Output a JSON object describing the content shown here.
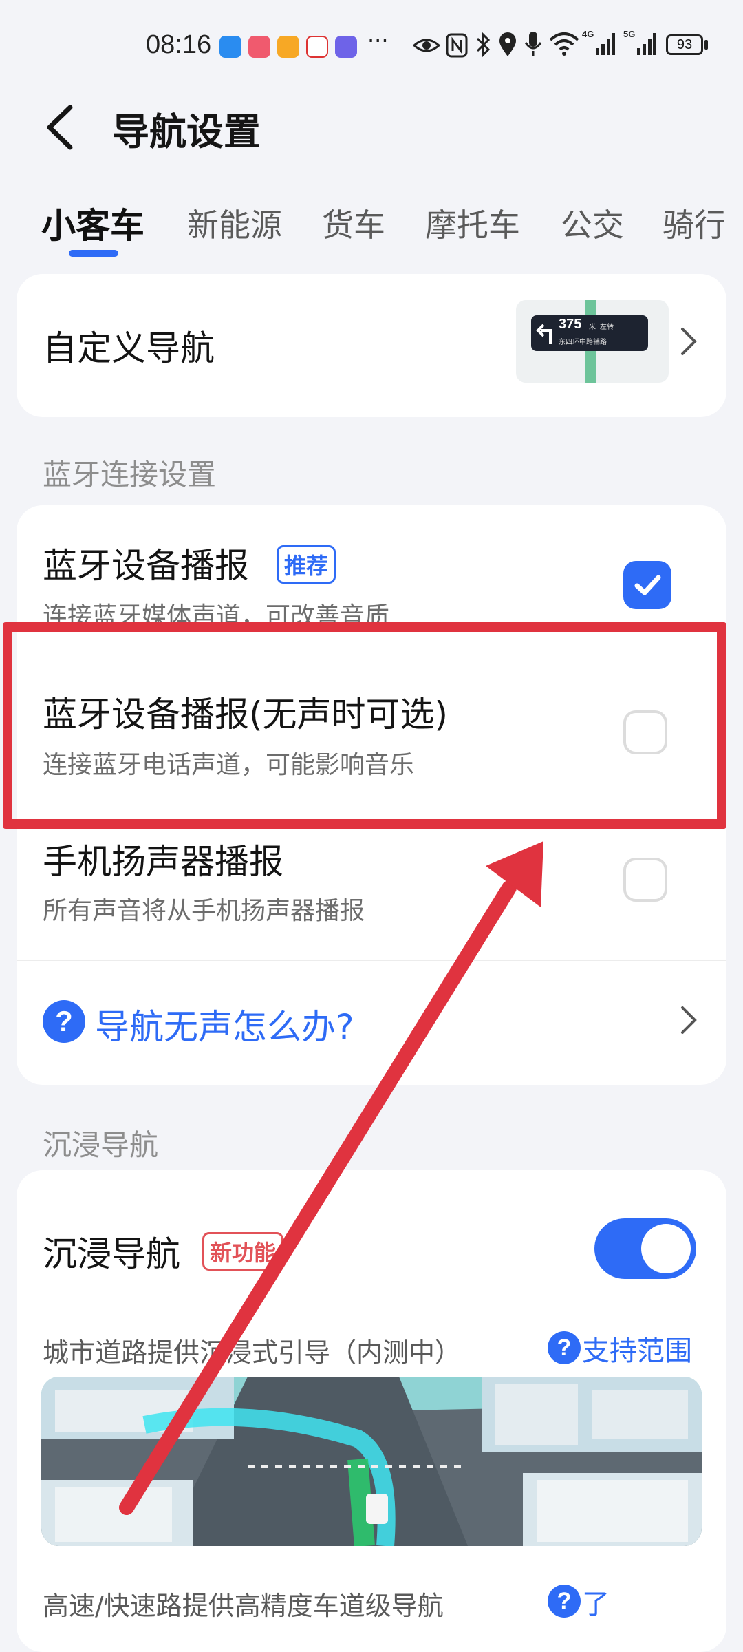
{
  "status_bar": {
    "time": "08:16",
    "battery": "93",
    "more": "···",
    "icons": [
      "eye-icon",
      "nfc-icon",
      "bluetooth-icon",
      "location-icon",
      "mic-icon",
      "wifi-icon",
      "signal-4g-icon",
      "signal-5g-icon"
    ]
  },
  "header": {
    "title": "导航设置"
  },
  "tabs": [
    {
      "label": "小客车",
      "active": true
    },
    {
      "label": "新能源"
    },
    {
      "label": "货车"
    },
    {
      "label": "摩托车"
    },
    {
      "label": "公交"
    },
    {
      "label": "骑行"
    }
  ],
  "custom_nav": {
    "label": "自定义导航",
    "preview": {
      "distance": "375",
      "unit": "米",
      "turn": "左转",
      "road": "东四环中路辅路"
    }
  },
  "bluetooth": {
    "section_label": "蓝牙连接设置",
    "options": [
      {
        "title": "蓝牙设备播报",
        "badge": "推荐",
        "subtitle": "连接蓝牙媒体声道，可改善音质",
        "checked": true
      },
      {
        "title": "蓝牙设备播报(无声时可选)",
        "subtitle": "连接蓝牙电话声道，可能影响音乐",
        "checked": false
      },
      {
        "title": "手机扬声器播报",
        "subtitle": "所有声音将从手机扬声器播报",
        "checked": false
      }
    ],
    "help_link": "导航无声怎么办?"
  },
  "immersive": {
    "section_label": "沉浸导航",
    "title": "沉浸导航",
    "badge": "新功能",
    "toggle_on": true,
    "city_desc": "城市道路提供沉浸式引导（内测中）",
    "support_link": "支持范围",
    "highway_desc": "高速/快速路提供高精度车道级导航",
    "highway_link": "了"
  },
  "colors": {
    "accent": "#2e6bf6",
    "highlight": "#e0333f",
    "badge_red": "#e25258"
  }
}
